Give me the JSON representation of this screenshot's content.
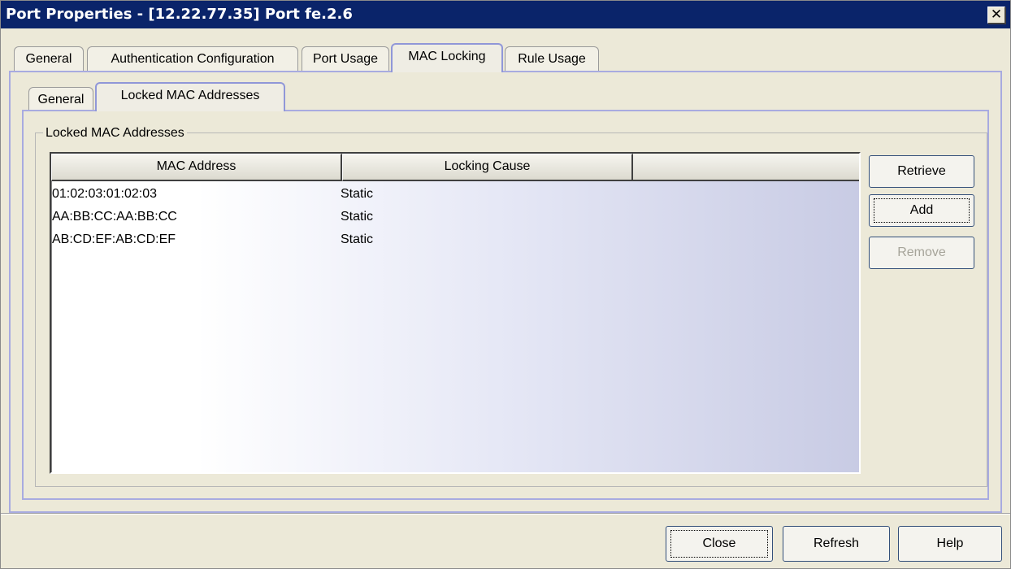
{
  "window": {
    "title": "Port Properties - [12.22.77.35] Port fe.2.6",
    "close_glyph": "✕"
  },
  "tabs": [
    {
      "label": "General"
    },
    {
      "label": "Authentication Configuration"
    },
    {
      "label": "Port Usage"
    },
    {
      "label": "MAC Locking",
      "active": true
    },
    {
      "label": "Rule Usage"
    }
  ],
  "subtabs": [
    {
      "label": "General"
    },
    {
      "label": "Locked MAC Addresses",
      "active": true
    }
  ],
  "group": {
    "title": "Locked MAC Addresses"
  },
  "table": {
    "columns": [
      "MAC Address",
      "Locking Cause"
    ],
    "rows": [
      {
        "mac": "01:02:03:01:02:03",
        "cause": "Static"
      },
      {
        "mac": "AA:BB:CC:AA:BB:CC",
        "cause": "Static"
      },
      {
        "mac": "AB:CD:EF:AB:CD:EF",
        "cause": "Static"
      }
    ]
  },
  "side_buttons": {
    "retrieve": "Retrieve",
    "add": "Add",
    "remove": "Remove"
  },
  "footer_buttons": {
    "close": "Close",
    "refresh": "Refresh",
    "help": "Help"
  },
  "colors": {
    "titlebar": "#0A246A",
    "panel_border": "#A8ABE0",
    "dialog_bg": "#ECE9D8"
  }
}
